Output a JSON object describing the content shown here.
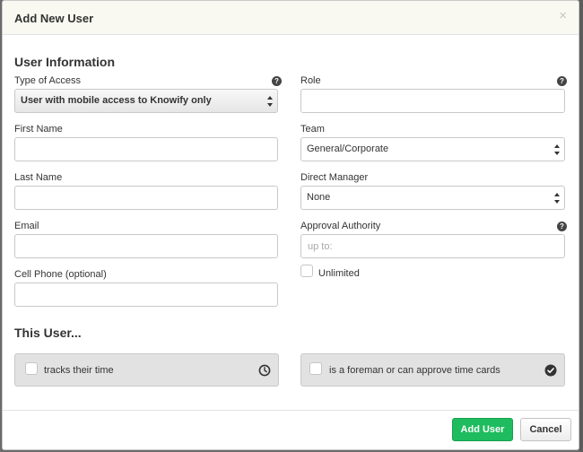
{
  "modal": {
    "title": "Add New User",
    "close_label": "×"
  },
  "user_info": {
    "section_title": "User Information",
    "type_of_access": {
      "label": "Type of Access",
      "value": "User with mobile access to Knowify only"
    },
    "role": {
      "label": "Role",
      "value": ""
    },
    "first_name": {
      "label": "First Name",
      "value": ""
    },
    "team": {
      "label": "Team",
      "value": "General/Corporate"
    },
    "last_name": {
      "label": "Last Name",
      "value": ""
    },
    "direct_manager": {
      "label": "Direct Manager",
      "value": "None"
    },
    "email": {
      "label": "Email",
      "value": ""
    },
    "approval_authority": {
      "label": "Approval Authority",
      "placeholder": "up to:",
      "value": ""
    },
    "cell_phone": {
      "label": "Cell Phone (optional)",
      "value": ""
    },
    "unlimited": {
      "label": "Unlimited",
      "checked": false
    }
  },
  "this_user": {
    "section_title": "This User...",
    "tracks_time": {
      "label": "tracks their time",
      "checked": false,
      "icon": "clock-icon"
    },
    "foreman": {
      "label": "is a foreman or can approve time cards",
      "checked": false,
      "icon": "check-circle-icon"
    }
  },
  "footer": {
    "add_user_label": "Add User",
    "cancel_label": "Cancel"
  },
  "colors": {
    "primary": "#1ebc5e",
    "header_bg": "#f9f9f1",
    "option_bg": "#e2e2e2"
  }
}
